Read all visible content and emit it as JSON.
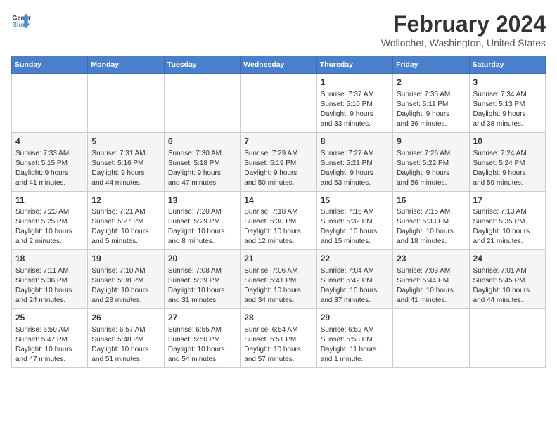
{
  "header": {
    "logo_line1": "General",
    "logo_line2": "Blue",
    "month": "February 2024",
    "location": "Wollochet, Washington, United States"
  },
  "weekdays": [
    "Sunday",
    "Monday",
    "Tuesday",
    "Wednesday",
    "Thursday",
    "Friday",
    "Saturday"
  ],
  "weeks": [
    [
      {
        "day": "",
        "info": ""
      },
      {
        "day": "",
        "info": ""
      },
      {
        "day": "",
        "info": ""
      },
      {
        "day": "",
        "info": ""
      },
      {
        "day": "1",
        "info": "Sunrise: 7:37 AM\nSunset: 5:10 PM\nDaylight: 9 hours\nand 33 minutes."
      },
      {
        "day": "2",
        "info": "Sunrise: 7:35 AM\nSunset: 5:11 PM\nDaylight: 9 hours\nand 36 minutes."
      },
      {
        "day": "3",
        "info": "Sunrise: 7:34 AM\nSunset: 5:13 PM\nDaylight: 9 hours\nand 38 minutes."
      }
    ],
    [
      {
        "day": "4",
        "info": "Sunrise: 7:33 AM\nSunset: 5:15 PM\nDaylight: 9 hours\nand 41 minutes."
      },
      {
        "day": "5",
        "info": "Sunrise: 7:31 AM\nSunset: 5:16 PM\nDaylight: 9 hours\nand 44 minutes."
      },
      {
        "day": "6",
        "info": "Sunrise: 7:30 AM\nSunset: 5:18 PM\nDaylight: 9 hours\nand 47 minutes."
      },
      {
        "day": "7",
        "info": "Sunrise: 7:29 AM\nSunset: 5:19 PM\nDaylight: 9 hours\nand 50 minutes."
      },
      {
        "day": "8",
        "info": "Sunrise: 7:27 AM\nSunset: 5:21 PM\nDaylight: 9 hours\nand 53 minutes."
      },
      {
        "day": "9",
        "info": "Sunrise: 7:26 AM\nSunset: 5:22 PM\nDaylight: 9 hours\nand 56 minutes."
      },
      {
        "day": "10",
        "info": "Sunrise: 7:24 AM\nSunset: 5:24 PM\nDaylight: 9 hours\nand 59 minutes."
      }
    ],
    [
      {
        "day": "11",
        "info": "Sunrise: 7:23 AM\nSunset: 5:25 PM\nDaylight: 10 hours\nand 2 minutes."
      },
      {
        "day": "12",
        "info": "Sunrise: 7:21 AM\nSunset: 5:27 PM\nDaylight: 10 hours\nand 5 minutes."
      },
      {
        "day": "13",
        "info": "Sunrise: 7:20 AM\nSunset: 5:29 PM\nDaylight: 10 hours\nand 8 minutes."
      },
      {
        "day": "14",
        "info": "Sunrise: 7:18 AM\nSunset: 5:30 PM\nDaylight: 10 hours\nand 12 minutes."
      },
      {
        "day": "15",
        "info": "Sunrise: 7:16 AM\nSunset: 5:32 PM\nDaylight: 10 hours\nand 15 minutes."
      },
      {
        "day": "16",
        "info": "Sunrise: 7:15 AM\nSunset: 5:33 PM\nDaylight: 10 hours\nand 18 minutes."
      },
      {
        "day": "17",
        "info": "Sunrise: 7:13 AM\nSunset: 5:35 PM\nDaylight: 10 hours\nand 21 minutes."
      }
    ],
    [
      {
        "day": "18",
        "info": "Sunrise: 7:11 AM\nSunset: 5:36 PM\nDaylight: 10 hours\nand 24 minutes."
      },
      {
        "day": "19",
        "info": "Sunrise: 7:10 AM\nSunset: 5:38 PM\nDaylight: 10 hours\nand 28 minutes."
      },
      {
        "day": "20",
        "info": "Sunrise: 7:08 AM\nSunset: 5:39 PM\nDaylight: 10 hours\nand 31 minutes."
      },
      {
        "day": "21",
        "info": "Sunrise: 7:06 AM\nSunset: 5:41 PM\nDaylight: 10 hours\nand 34 minutes."
      },
      {
        "day": "22",
        "info": "Sunrise: 7:04 AM\nSunset: 5:42 PM\nDaylight: 10 hours\nand 37 minutes."
      },
      {
        "day": "23",
        "info": "Sunrise: 7:03 AM\nSunset: 5:44 PM\nDaylight: 10 hours\nand 41 minutes."
      },
      {
        "day": "24",
        "info": "Sunrise: 7:01 AM\nSunset: 5:45 PM\nDaylight: 10 hours\nand 44 minutes."
      }
    ],
    [
      {
        "day": "25",
        "info": "Sunrise: 6:59 AM\nSunset: 5:47 PM\nDaylight: 10 hours\nand 47 minutes."
      },
      {
        "day": "26",
        "info": "Sunrise: 6:57 AM\nSunset: 5:48 PM\nDaylight: 10 hours\nand 51 minutes."
      },
      {
        "day": "27",
        "info": "Sunrise: 6:55 AM\nSunset: 5:50 PM\nDaylight: 10 hours\nand 54 minutes."
      },
      {
        "day": "28",
        "info": "Sunrise: 6:54 AM\nSunset: 5:51 PM\nDaylight: 10 hours\nand 57 minutes."
      },
      {
        "day": "29",
        "info": "Sunrise: 6:52 AM\nSunset: 5:53 PM\nDaylight: 11 hours\nand 1 minute."
      },
      {
        "day": "",
        "info": ""
      },
      {
        "day": "",
        "info": ""
      }
    ]
  ]
}
